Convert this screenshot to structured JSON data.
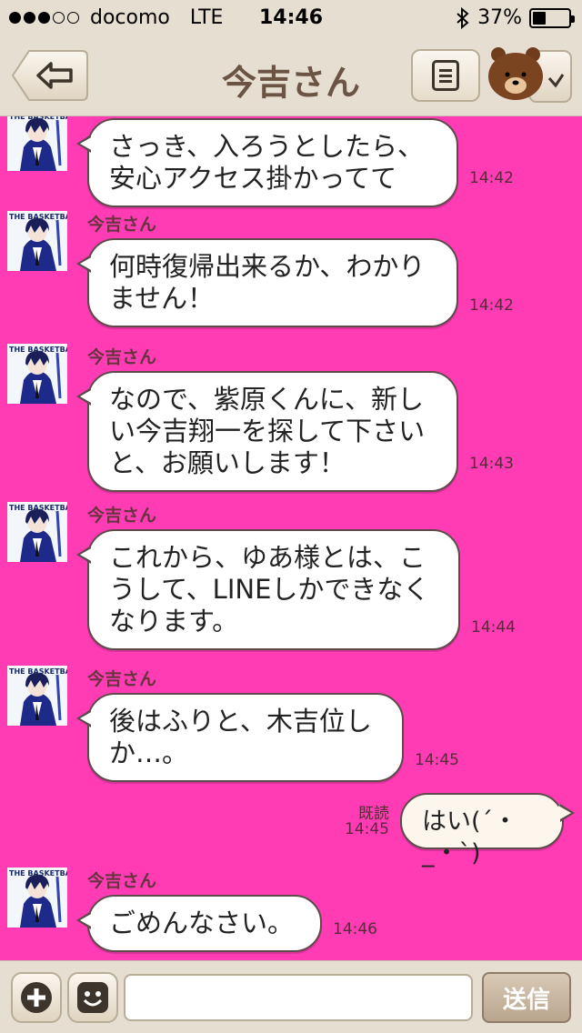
{
  "status_bar": {
    "carrier": "docomo",
    "network": "LTE",
    "time": "14:46",
    "battery": "37%",
    "battery_level": 0.37,
    "signal_bars_filled": 3,
    "signal_bars_total": 5
  },
  "header": {
    "title": "今吉さん",
    "back_icon": "back-arrow-icon",
    "menu_icon": "list-menu-icon",
    "sticker_icon": "brown-bear-icon"
  },
  "messages": [
    {
      "sender": "",
      "text": "さっき、入ろうとしたら、\n安心アクセス掛かってて",
      "time": "14:42"
    },
    {
      "sender": "今吉さん",
      "text": "何時復帰出来るか、わかり\nません！",
      "time": "14:42"
    },
    {
      "sender": "今吉さん",
      "text": "なので、紫原くんに、新し\nい今吉翔一を探して下さい\nと、お願いします！",
      "time": "14:43"
    },
    {
      "sender": "今吉さん",
      "text": "これから、ゆあ様とは、こ\nうして、LINEしかできなく\nなります。",
      "time": "14:44"
    },
    {
      "sender": "今吉さん",
      "text": "後はふりと、木吉位し\nか…。",
      "time": "14:45"
    },
    {
      "sender": "今吉さん",
      "text": "ごめんなさい。",
      "time": "14:46"
    }
  ],
  "outgoing": {
    "text": "はい(´・_・`)",
    "read_label": "既読",
    "time": "14:45"
  },
  "avatar_text": "THE BASKETBALL",
  "input_bar": {
    "placeholder": "",
    "send_label": "送信",
    "add_icon": "plus-icon",
    "emoji_icon": "smiley-icon"
  },
  "colors": {
    "background": "#ff3cb4",
    "bar": "#e6ded1",
    "title_text": "#6b5443"
  }
}
